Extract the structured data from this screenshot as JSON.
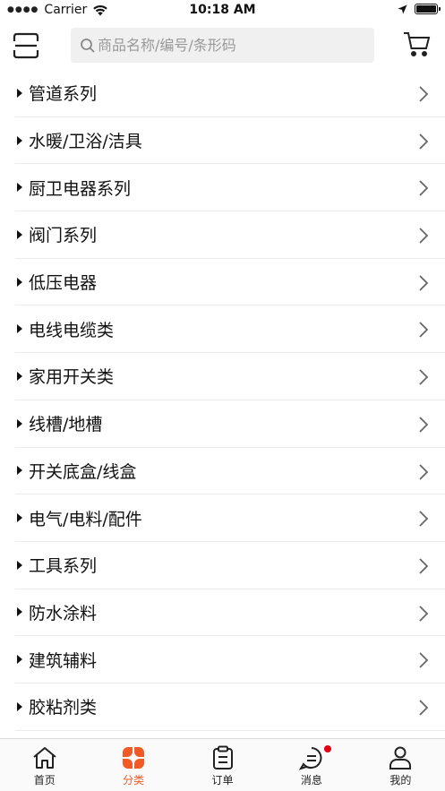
{
  "status_bar": {
    "carrier": "Carrier",
    "time": "10:18 AM"
  },
  "search": {
    "placeholder": "商品名称/编号/条形码"
  },
  "categories": [
    {
      "label": "管道系列"
    },
    {
      "label": "水暖/卫浴/洁具"
    },
    {
      "label": "厨卫电器系列"
    },
    {
      "label": "阀门系列"
    },
    {
      "label": "低压电器"
    },
    {
      "label": "电线电缆类"
    },
    {
      "label": "家用开关类"
    },
    {
      "label": "线槽/地槽"
    },
    {
      "label": "开关底盒/线盒"
    },
    {
      "label": "电气/电料/配件"
    },
    {
      "label": "工具系列"
    },
    {
      "label": "防水涂料"
    },
    {
      "label": "建筑辅料"
    },
    {
      "label": "胶粘剂类"
    }
  ],
  "tabs": [
    {
      "label": "首页",
      "icon": "home-icon"
    },
    {
      "label": "分类",
      "icon": "category-icon",
      "active": true
    },
    {
      "label": "订单",
      "icon": "order-icon"
    },
    {
      "label": "消息",
      "icon": "message-icon",
      "badge": true
    },
    {
      "label": "我的",
      "icon": "profile-icon"
    }
  ],
  "colors": {
    "accent": "#f15a24",
    "badge": "#e60012",
    "search_bg": "#f0f0f0",
    "divider": "#ececec"
  }
}
